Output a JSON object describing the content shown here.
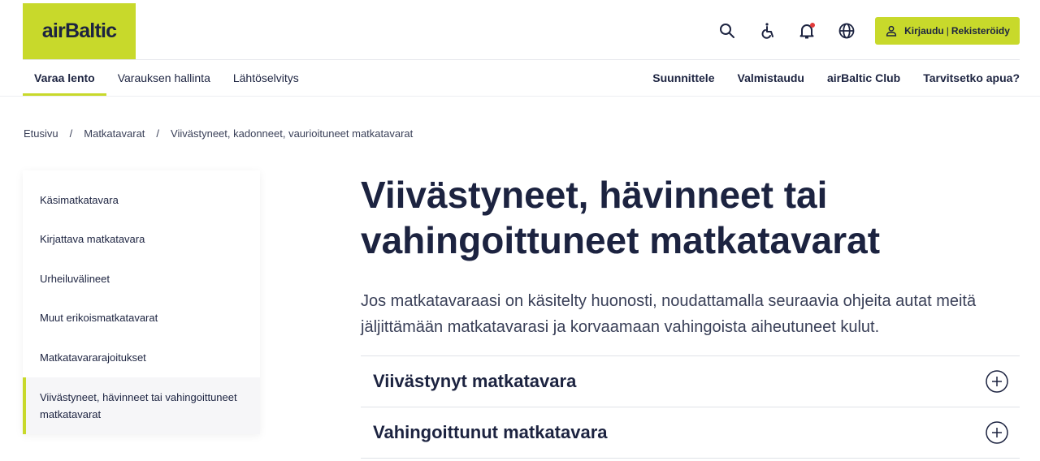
{
  "logo": {
    "text": "airBaltic"
  },
  "header": {
    "icons": [
      "search-icon",
      "accessibility-icon",
      "bell-icon",
      "globe-icon"
    ],
    "login": {
      "login_label": "Kirjaudu",
      "separator": "|",
      "register_label": "Rekisteröidy"
    }
  },
  "nav": {
    "left": [
      {
        "label": "Varaa lento",
        "active": true
      },
      {
        "label": "Varauksen hallinta"
      },
      {
        "label": "Lähtöselvitys"
      }
    ],
    "right": [
      {
        "label": "Suunnittele"
      },
      {
        "label": "Valmistaudu"
      },
      {
        "label": "airBaltic Club"
      },
      {
        "label": "Tarvitsetko apua?"
      }
    ]
  },
  "breadcrumb": {
    "items": [
      "Etusivu",
      "Matkatavarat",
      "Viivästyneet, kadonneet, vaurioituneet matkatavarat"
    ],
    "separator": "/"
  },
  "sidebar": {
    "items": [
      {
        "label": "Käsimatkatavara"
      },
      {
        "label": "Kirjattava matkatavara"
      },
      {
        "label": "Urheiluvälineet"
      },
      {
        "label": "Muut erikoismatkatavarat"
      },
      {
        "label": "Matkatavararajoitukset"
      },
      {
        "label": "Viivästyneet, hävinneet tai vahingoittuneet matkatavarat",
        "active": true
      }
    ]
  },
  "main": {
    "title": "Viivästyneet, hävinneet tai vahingoittuneet matkatavarat",
    "description": "Jos matkatavaraasi on käsitelty huonosti, noudattamalla seuraavia ohjeita autat meitä jäljittämään matkatavarasi ja korvaamaan vahingoista aiheutuneet kulut.",
    "accordion": [
      {
        "title": "Viivästynyt matkatavara"
      },
      {
        "title": "Vahingoittunut matkatavara"
      }
    ]
  },
  "colors": {
    "brand_lime": "#c8d92b",
    "text_navy": "#1c2340",
    "notification_red": "#e23a3a"
  }
}
